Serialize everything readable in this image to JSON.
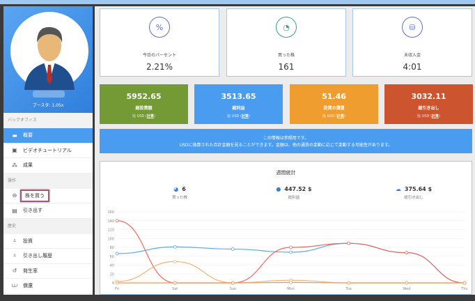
{
  "sidebar": {
    "booster": "ブースタ: 1.05x",
    "sections": [
      {
        "title": "バックオフィス",
        "items": [
          {
            "label": "概要",
            "icon": "briefcase-icon",
            "active": true
          },
          {
            "label": "ビデオチュートリアル",
            "icon": "monitor-icon"
          },
          {
            "label": "成果",
            "icon": "sitemap-icon"
          }
        ]
      },
      {
        "title": "操作",
        "items": [
          {
            "label": "株を買う",
            "icon": "cart-icon",
            "highlight": true
          },
          {
            "label": "引き出す",
            "icon": "wallet-icon"
          }
        ]
      },
      {
        "title": "歴史",
        "items": [
          {
            "label": "投資",
            "icon": "download-icon"
          },
          {
            "label": "引き出し履歴",
            "icon": "download-icon"
          },
          {
            "label": "発生率",
            "icon": "history-icon"
          },
          {
            "label": "償還",
            "icon": "tray-icon"
          }
        ]
      }
    ]
  },
  "top_cards": [
    {
      "label": "今日のパーセント",
      "value": "2.21%",
      "icon": "percent-icon"
    },
    {
      "label": "買った株",
      "value": "161",
      "icon": "pie-icon"
    },
    {
      "label": "未収入金",
      "value": "4:01",
      "icon": "coins-clock-icon"
    }
  ],
  "color_cards": [
    {
      "value": "5952.65",
      "label": "総投資額",
      "sub": "比 USD",
      "link": "計算",
      "color": "#739a35"
    },
    {
      "value": "3513.65",
      "label": "総利益",
      "sub": "比 USD",
      "link": "計算",
      "color": "#4a9cf0"
    },
    {
      "value": "51.46",
      "label": "投資の償還",
      "sub": "比 USD",
      "link": "計算",
      "color": "#f09d30"
    },
    {
      "value": "3032.11",
      "label": "総引き出し",
      "sub": "比 USD",
      "link": "計算",
      "color": "#cc552f"
    }
  ],
  "banner": {
    "line1": "この情報は参照用です。",
    "line2": "USDに換算された合計金額を見ることができます。金額は、他の通貨の変動に応じて変動する可能性があります。"
  },
  "weekly": {
    "title": "週間統計",
    "stats": [
      {
        "value": "6",
        "label": "買った株"
      },
      {
        "value": "447.52 $",
        "label": "総利益"
      },
      {
        "value": "375.64 $",
        "label": "総引き出し"
      }
    ]
  },
  "chart_data": {
    "type": "line",
    "categories": [
      "Fri",
      "Sat",
      "Sun",
      "Mon",
      "Tue",
      "Wed",
      "Thu"
    ],
    "ylim": [
      0,
      160
    ],
    "yticks": [
      0,
      20,
      40,
      60,
      80,
      100,
      120,
      140,
      160
    ],
    "series": [
      {
        "name": "blue",
        "color": "#5aa8f5",
        "values": [
          66,
          81,
          76,
          69,
          89,
          68,
          0
        ]
      },
      {
        "name": "red",
        "color": "#ee6a5a",
        "values": [
          140,
          0,
          0,
          80,
          89,
          68,
          0
        ]
      },
      {
        "name": "orange",
        "color": "#f7b070",
        "values": [
          3,
          48,
          0,
          6,
          0,
          0,
          0
        ]
      },
      {
        "name": "orange2",
        "color": "#f59a3a",
        "values": [
          0,
          0,
          0,
          1,
          0,
          0,
          0
        ]
      }
    ]
  }
}
